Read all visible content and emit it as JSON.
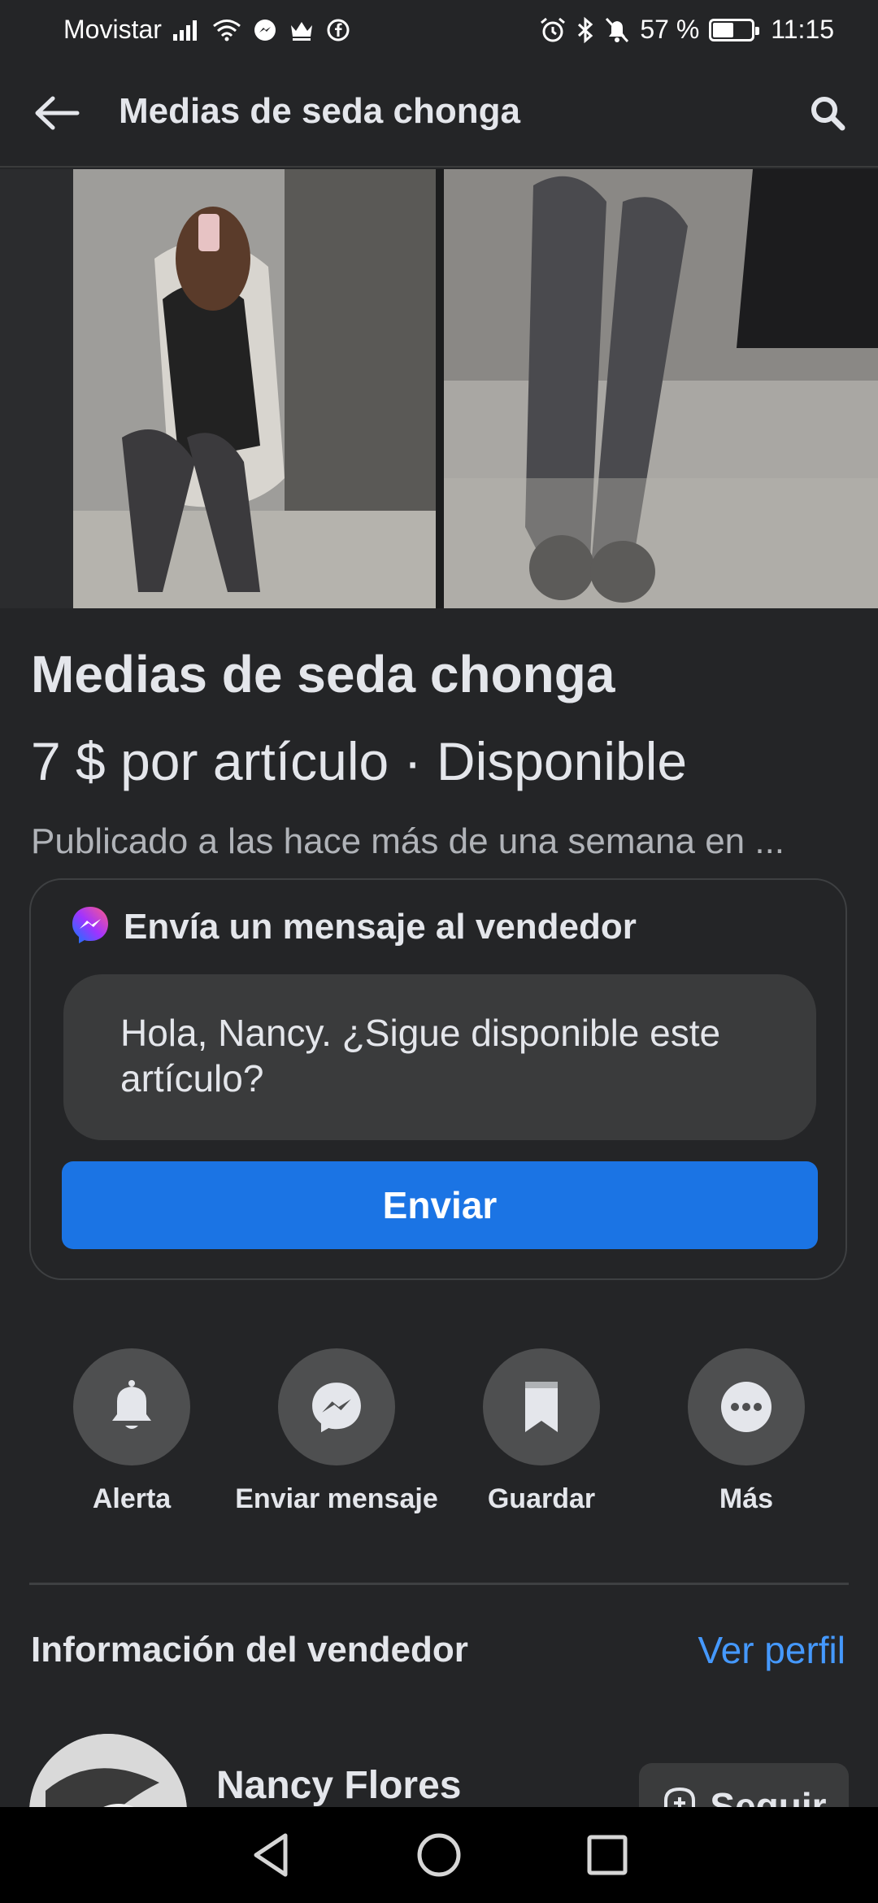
{
  "status_bar": {
    "carrier": "Movistar",
    "battery_text": "57 %",
    "battery_level": 0.57,
    "time": "11:15"
  },
  "app_bar": {
    "title": "Medias de seda chonga"
  },
  "listing": {
    "title": "Medias de seda chonga",
    "price_line": "7 $ por artículo · Disponible",
    "posted": "Publicado a las hace más de una semana en ..."
  },
  "message_card": {
    "heading": "Envía un mensaje al vendedor",
    "message": "Hola, Nancy. ¿Sigue disponible este artículo?",
    "send_label": "Enviar"
  },
  "actions": [
    {
      "label": "Alerta",
      "icon": "bell-icon"
    },
    {
      "label": "Enviar mensaje",
      "icon": "messenger-icon"
    },
    {
      "label": "Guardar",
      "icon": "bookmark-icon"
    },
    {
      "label": "Más",
      "icon": "more-icon"
    }
  ],
  "seller": {
    "heading": "Información del vendedor",
    "view_profile": "Ver perfil",
    "name": "Nancy Flores",
    "follow_label": "Seguir"
  },
  "colors": {
    "background": "#242527",
    "accent": "#1b74e4",
    "link": "#4599ff"
  }
}
